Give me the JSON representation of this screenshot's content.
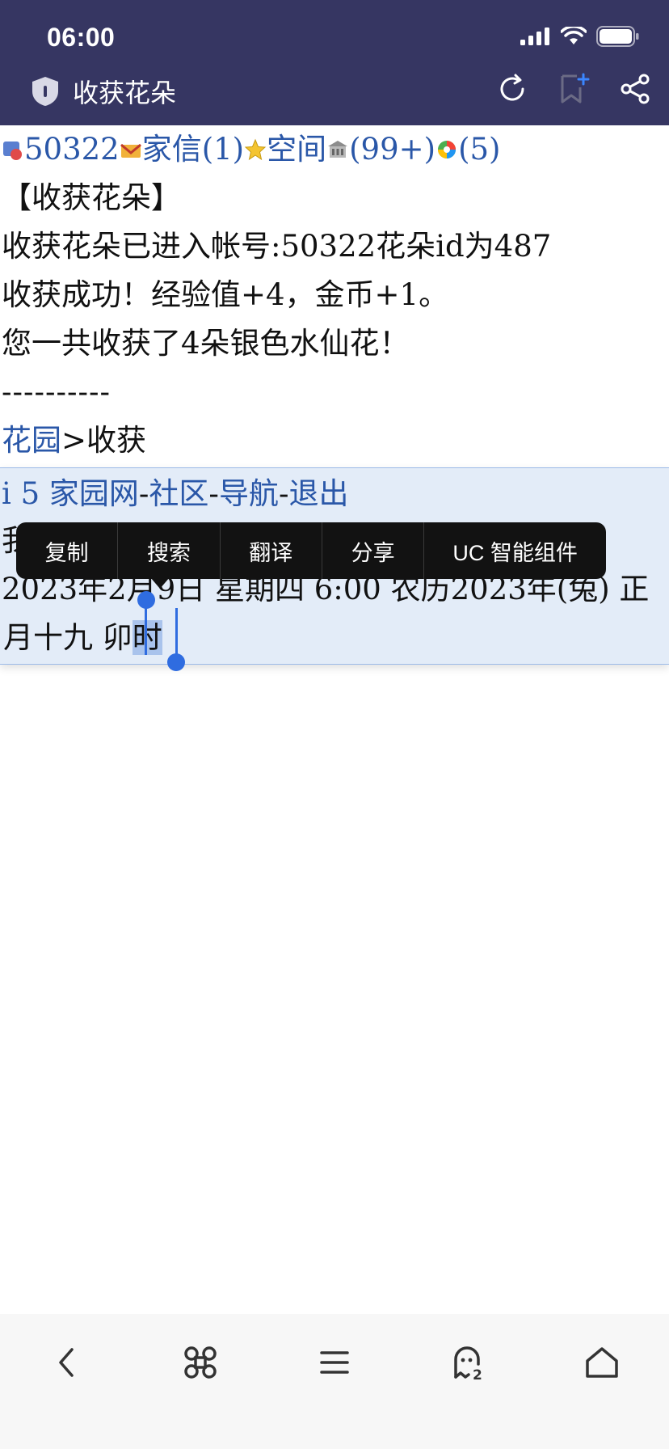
{
  "status_bar": {
    "time": "06:00"
  },
  "browser": {
    "page_title": "收获花朵"
  },
  "nav_line": {
    "user_id": "50322",
    "mail_label": "家信(1)",
    "space_label": "空间",
    "count_label": "(99+)",
    "wheel_label": "(5)"
  },
  "content": {
    "heading": "【收获花朵】",
    "message1": "收获花朵已进入帐号:50322花朵id为487",
    "message2": "收获成功！经验值+4，金币+1。",
    "message3": "您一共收获了4朵银色水仙花！",
    "divider": "----------",
    "breadcrumb_link": "花园",
    "breadcrumb_sep": ">",
    "breadcrumb_current": "收获"
  },
  "footer": {
    "site_link": "i 5 家园网",
    "sep": "-",
    "community_link": "社区",
    "nav_link": "导航",
    "logout_link": "退出",
    "hidden_line_start": "我",
    "date_line": "2023年2月9日  星期四  6:00  农历2023年(兔)  正",
    "lunar_line_before": "月十九  卯",
    "lunar_line_selected": "时"
  },
  "context_menu": {
    "items": [
      "复制",
      "搜索",
      "翻译",
      "分享",
      "UC 智能组件"
    ]
  },
  "colors": {
    "topbar": "#363662",
    "link": "#2a57a8",
    "selection": "#a9c3ec",
    "handle": "#2f6ce0"
  }
}
